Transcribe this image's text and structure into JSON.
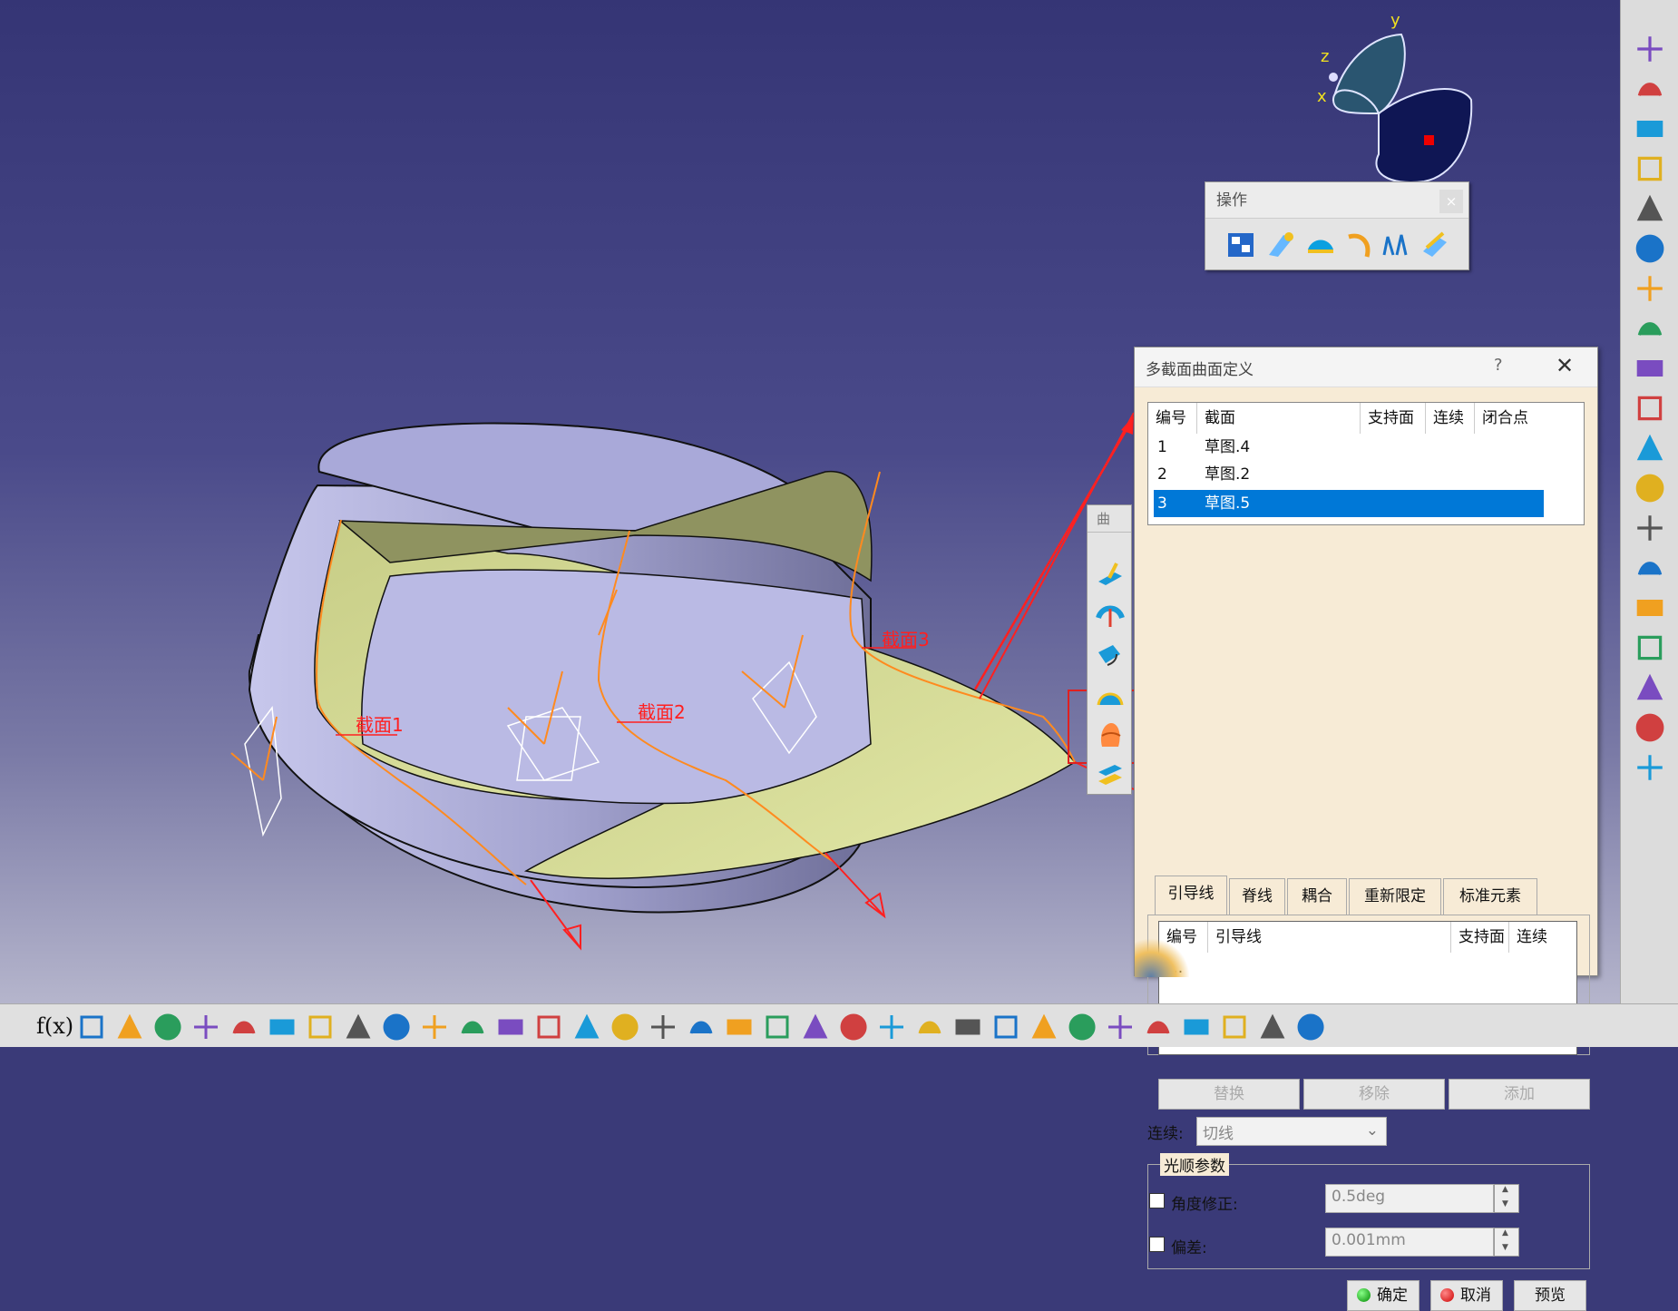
{
  "viewport": {
    "section_labels": [
      "截面1",
      "截面2",
      "截面3"
    ],
    "compass": {
      "x": "x",
      "y": "y",
      "z": "z"
    }
  },
  "operations_toolbar": {
    "title": "操作",
    "close": "×",
    "icons": [
      "join-icon",
      "heal-icon",
      "untrim-icon",
      "disassemble-icon",
      "split-icon",
      "extract-icon"
    ]
  },
  "surfaces_toolbar": {
    "title": "曲",
    "icons": [
      "extrude-icon",
      "revolve-icon",
      "sweep-icon",
      "fill-icon",
      "multi-section-surface-icon",
      "blend-icon"
    ]
  },
  "dialog": {
    "title": "多截面曲面定义",
    "help": "?",
    "close": "✕",
    "sections_table": {
      "headers": [
        "编号",
        "截面",
        "支持面",
        "连续",
        "闭合点"
      ],
      "rows": [
        {
          "no": "1",
          "section": "草图.4"
        },
        {
          "no": "2",
          "section": "草图.2"
        },
        {
          "no": "3",
          "section": "草图.5",
          "selected": true
        }
      ]
    },
    "tabs": [
      "引导线",
      "脊线",
      "耦合",
      "重新限定",
      "标准元素"
    ],
    "guides_table": {
      "headers": [
        "编号",
        "引导线",
        "支持面",
        "连续"
      ],
      "placeholder": "..."
    },
    "buttons": {
      "replace": "替换",
      "remove": "移除",
      "add": "添加"
    },
    "continuity_label": "连续:",
    "continuity_value": "切线",
    "smooth_group": "光顺参数",
    "angle_label": "角度修正:",
    "angle_value": "0.5deg",
    "deviation_label": "偏差:",
    "deviation_value": "0.001mm",
    "ok": "确定",
    "cancel": "取消",
    "preview": "预览"
  },
  "bottom_toolbar": {
    "formula_label": "f(x)",
    "icons": [
      "formula-icon",
      "comment-icon",
      "lock-icon",
      "table-icon",
      "tree-icon",
      "catalog-icon",
      "macro-icon",
      "fly-icon",
      "fit-all-icon",
      "pan-icon",
      "rotate-icon",
      "zoom-in-icon",
      "zoom-out-icon",
      "normal-view-icon",
      "multi-view-icon",
      "iso-view-icon",
      "shading-icon",
      "hide-show-icon",
      "swap-icon",
      "measure-icon",
      "inertia-icon",
      "capture-icon",
      "surface-analysis-icon",
      "hand-icon",
      "axis-icon",
      "grid-icon",
      "snap-icon",
      "wireframe-icon",
      "box-icon",
      "dimension-icon",
      "tolerance-icon",
      "tree-compact-icon",
      "annotation-icon",
      "part-icon"
    ]
  },
  "right_toolbar": {
    "icons": [
      "doc-icon",
      "doc-icon",
      "doc-icon",
      "doc-icon",
      "select-arrow-icon",
      "snap-point-icon",
      "sketch-icon",
      "point-icon",
      "line-icon",
      "plane-icon",
      "extrude-surface-icon",
      "sweep-surface-icon",
      "fill-surface-icon",
      "circle-icon",
      "spline-icon",
      "axis-system-icon",
      "render-icon",
      "material-icon",
      "apply-material-icon"
    ]
  },
  "colors": {
    "selection": "#0078d7",
    "surface": "#d7dd9a",
    "cylinder": "#b9b9e0",
    "guide": "#ff8a1f",
    "annotation": "#ff2020"
  }
}
